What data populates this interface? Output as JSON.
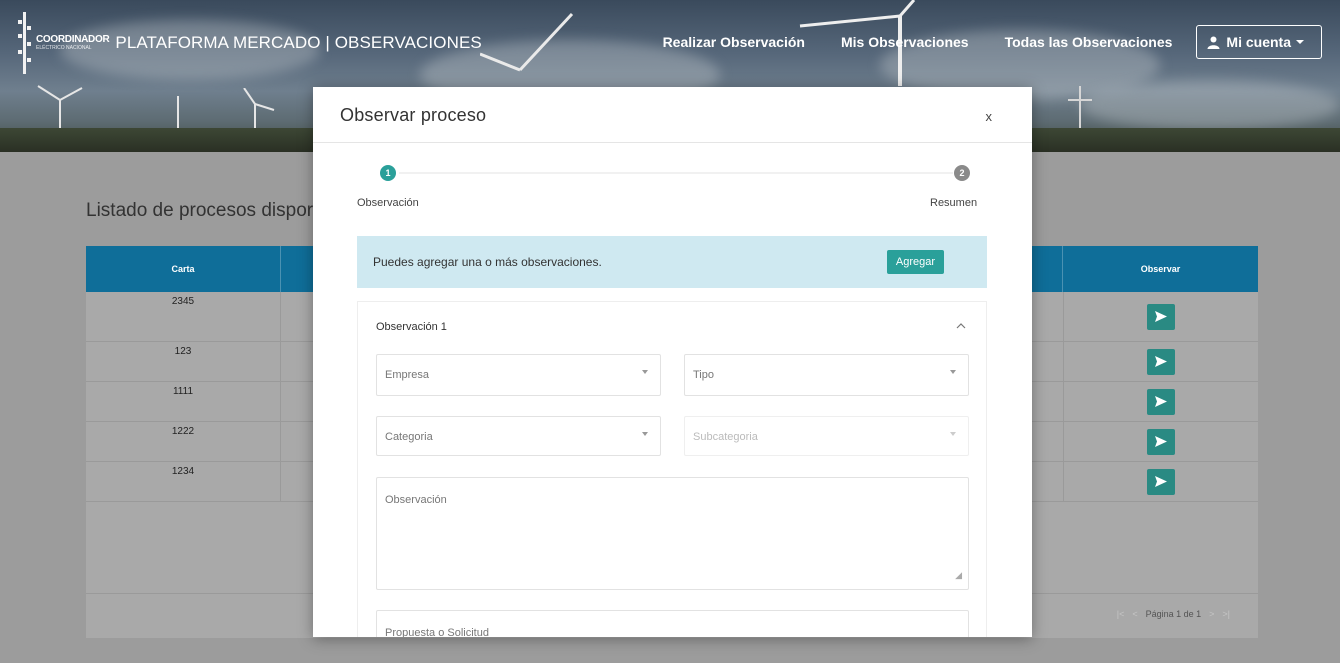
{
  "header": {
    "logo_line1": "COORDINADOR",
    "logo_line2": "ELÉCTRICO NACIONAL",
    "app_title": "PLATAFORMA MERCADO | OBSERVACIONES",
    "nav": [
      "Realizar Observación",
      "Mis Observaciones",
      "Todas las Observaciones"
    ],
    "account_label": "Mi cuenta",
    "account_icon": "user-icon"
  },
  "page": {
    "heading": "Listado de procesos dispor",
    "table": {
      "col_first": "Carta",
      "col_last": "Observar",
      "rows": [
        "2345",
        "123",
        "1111",
        "1222",
        "1234"
      ],
      "action_icon": "send-icon"
    },
    "pager": {
      "first": "|<",
      "prev": "<",
      "text": "Página 1 de 1",
      "next": ">",
      "last": ">|"
    }
  },
  "modal": {
    "title": "Observar proceso",
    "close": "x",
    "steps": [
      {
        "number": "1",
        "label": "Observación"
      },
      {
        "number": "2",
        "label": "Resumen"
      }
    ],
    "info_text": "Puedes agregar una o más observaciones.",
    "add_button": "Agregar",
    "observation": {
      "title": "Observación 1",
      "fields": {
        "empresa": "Empresa",
        "tipo": "Tipo",
        "categoria": "Categoria",
        "subcategoria": "Subcategoria",
        "observacion": "Observación",
        "propuesta": "Propuesta o Solicitud"
      }
    }
  },
  "colors": {
    "table_header": "#0f6e99",
    "accent": "#2aa09a",
    "step_active": "#2aa09a",
    "step_inactive": "#8a8a8a",
    "info_bg": "#cfe9f1"
  }
}
